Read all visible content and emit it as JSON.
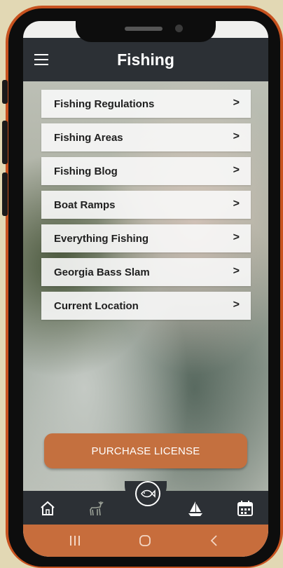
{
  "header": {
    "title": "Fishing"
  },
  "menu": {
    "items": [
      {
        "label": "Fishing Regulations"
      },
      {
        "label": "Fishing Areas"
      },
      {
        "label": "Fishing Blog"
      },
      {
        "label": "Boat Ramps"
      },
      {
        "label": "Everything Fishing"
      },
      {
        "label": "Georgia Bass Slam"
      },
      {
        "label": "Current Location"
      }
    ],
    "chevron": ">"
  },
  "purchase": {
    "label": "PURCHASE LICENSE"
  },
  "bottom_nav": {
    "icons": [
      "home-icon",
      "deer-icon",
      "fish-icon",
      "sailboat-icon",
      "calendar-icon"
    ]
  },
  "colors": {
    "frame": "#c7521f",
    "header": "#2c3035",
    "button": "#c4703f",
    "android_bar": "#c76d3c"
  }
}
